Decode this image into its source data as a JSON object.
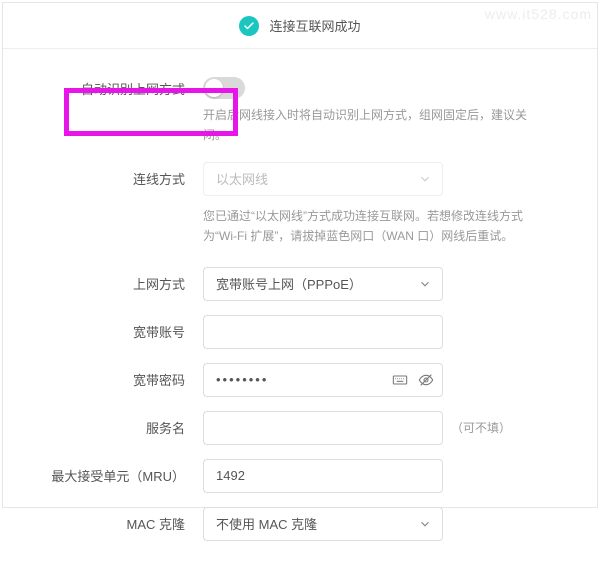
{
  "watermark": "www.it528.com",
  "status": {
    "text": "连接互联网成功"
  },
  "auto_detect": {
    "label": "自动识别上网方式",
    "on": false,
    "hint": "开启后网线接入时将自动识别上网方式，组网固定后，建议关闭。"
  },
  "connection_method": {
    "label": "连线方式",
    "value": "以太网线",
    "disabled": true,
    "hint": "您已通过“以太网线”方式成功连接互联网。若想修改连线方式为“Wi-Fi 扩展”，请拔掉蓝色网口（WAN 口）网线后重试。"
  },
  "internet_mode": {
    "label": "上网方式",
    "value": "宽带账号上网（PPPoE）"
  },
  "account": {
    "label": "宽带账号",
    "value": ""
  },
  "password": {
    "label": "宽带密码",
    "value": "••••••••"
  },
  "service": {
    "label": "服务名",
    "value": "",
    "optional": "（可不填）"
  },
  "mru": {
    "label": "最大接受单元（MRU）",
    "value": "1492"
  },
  "mac_clone": {
    "label": "MAC 克隆",
    "value": "不使用 MAC 克隆"
  },
  "colors": {
    "accent": "#1bc6c0",
    "highlight": "#e815e8"
  }
}
